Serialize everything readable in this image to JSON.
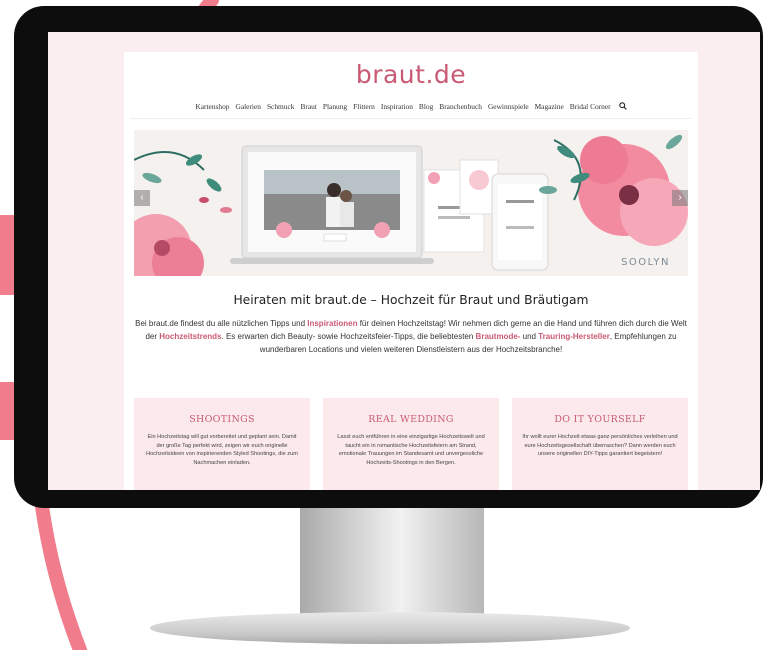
{
  "site": {
    "logo": "braut.de",
    "nav": [
      "Kartenshop",
      "Galerien",
      "Schmuck",
      "Braut",
      "Planung",
      "Flittern",
      "Inspiration",
      "Blog",
      "Branchenbuch",
      "Gewinnspiele",
      "Magazine",
      "Bridal Corner"
    ],
    "search_icon": "search-icon"
  },
  "hero": {
    "brand": "SOOLYN",
    "prev_icon": "chevron-left-icon",
    "next_icon": "chevron-right-icon"
  },
  "main": {
    "heading": "Heiraten mit braut.de – Hochzeit für Braut und Bräutigam",
    "intro": {
      "p1": "Bei braut.de findest du alle nützlichen Tipps und ",
      "l1": "Inspirationen",
      "p2": " für deinen Hochzeitstag! Wir nehmen dich gerne an die Hand und führen dich durch die Welt der ",
      "l2": "Hochzeitstrends",
      "p3": ". Es erwarten dich Beauty- sowie Hochzeitsfeier-Tipps, die beliebtesten ",
      "l3": "Brautmode-",
      "p4": " und ",
      "l4": "Trauring-Hersteller",
      "p5": ", Empfehlungen zu wunderbaren Locations und vielen weiteren Dienstleistern aus der Hochzeitsbranche!"
    }
  },
  "cards": [
    {
      "title": "SHOOTINGS",
      "text": "Ein Hochzeitstag will gut vorbereitet und geplant sein. Damit der große Tag perfekt wird, zeigen wir euch originelle Hochzeitsideen von inspirierenden Styled Shootings, die zum Nachmachen einladen."
    },
    {
      "title": "REAL WEDDING",
      "text": "Lasst euch entführen in eine einzigartige Hochzeitswelt und taucht ein in romantische Hochzeitsfeiern am Strand, emotionale Trauungen im Standesamt und unvergessliche Hochzeits-Shootings in den Bergen."
    },
    {
      "title": "DO IT YOURSELF",
      "text": "Ihr wollt eurer Hochzeit etwas ganz persönliches verleihen und eure Hochzeitsgesellschaft überraschen? Dann werden euch unsere originellen DIY-Tipps garantiert begeistern!"
    }
  ],
  "colors": {
    "accent": "#c95a74",
    "card_bg": "#fbe9ec",
    "screen_bg": "#fbeef0",
    "bezel": "#0d0d0d"
  }
}
